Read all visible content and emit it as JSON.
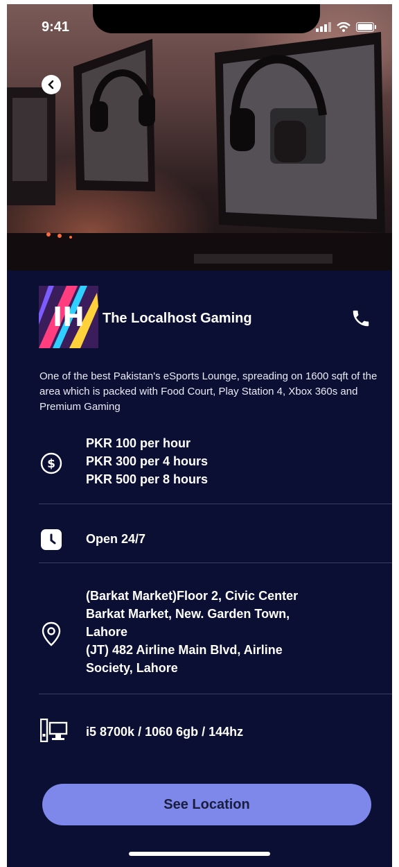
{
  "status_bar": {
    "time": "9:41"
  },
  "venue": {
    "name": "The Localhost Gaming",
    "description": "One of the best Pakistan's eSports Lounge, spreading on 1600 sqft of the area which is packed with Food Court, Play Station 4, Xbox 360s and Premium Gaming"
  },
  "pricing": {
    "icon": "dollar-circle-icon",
    "lines": [
      "PKR 100 per hour",
      "PKR 300 per 4 hours",
      "PKR 500 per 8 hours"
    ]
  },
  "hours": {
    "icon": "clock-icon",
    "text": "Open 24/7"
  },
  "address": {
    "icon": "location-pin-icon",
    "lines": [
      "(Barkat Market)Floor 2, Civic Center",
      "Barkat Market, New. Garden Town,",
      "Lahore",
      "(JT) 482 Airline Main Blvd, Airline",
      "Society, Lahore"
    ]
  },
  "specs": {
    "icon": "desktop-computer-icon",
    "text": "i5 8700k / 1060 6gb / 144hz"
  },
  "cta": {
    "label": "See Location"
  },
  "colors": {
    "background": "#0b0f33",
    "accent": "#7d88ea",
    "divider": "#3a3f63"
  }
}
